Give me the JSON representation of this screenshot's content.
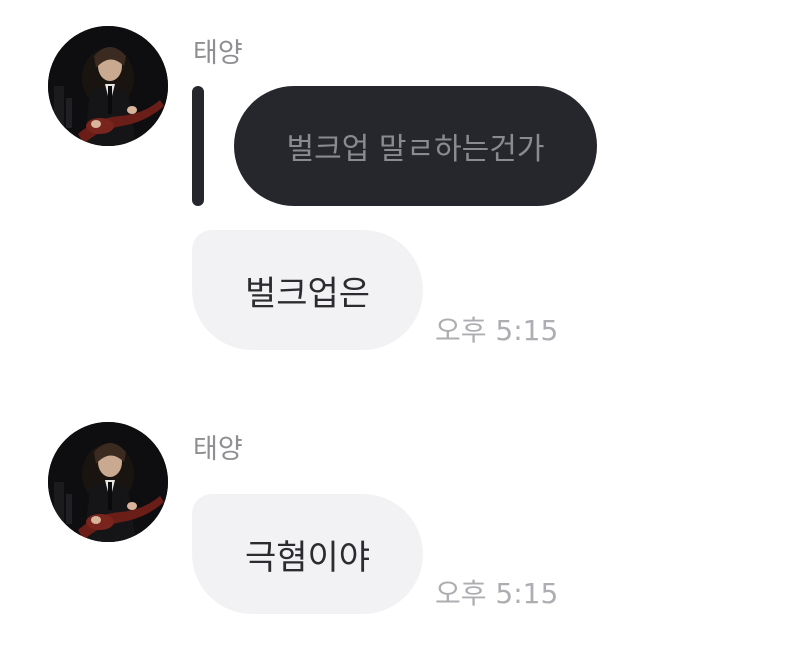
{
  "messages": [
    {
      "sender": "태양",
      "reply_preview": "벌크업 말ㄹ하는건가",
      "text": "벌크업은",
      "time": "오후 5:15"
    },
    {
      "sender": "태양",
      "text": "극혐이야",
      "time": "오후 5:15"
    }
  ],
  "colors": {
    "reply_bubble_bg": "#26272d",
    "bubble_bg": "#f2f2f4",
    "timestamp": "#aeaeb2",
    "sender_name": "#8e8e93"
  }
}
